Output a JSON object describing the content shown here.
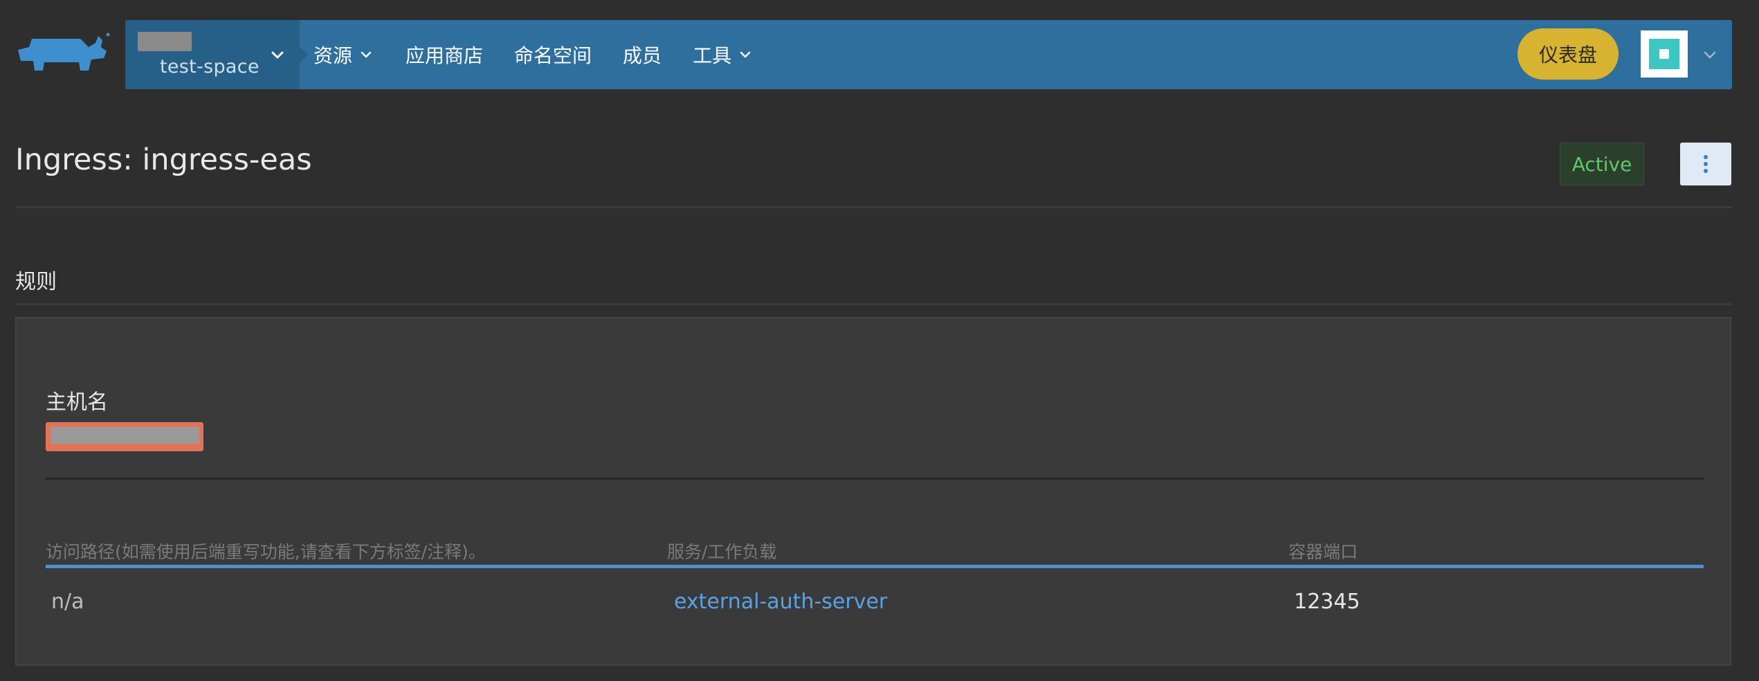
{
  "header": {
    "project_name": "test-space",
    "nav_items": [
      {
        "label": "资源",
        "has_dropdown": true
      },
      {
        "label": "应用商店",
        "has_dropdown": false
      },
      {
        "label": "命名空间",
        "has_dropdown": false
      },
      {
        "label": "成员",
        "has_dropdown": false
      },
      {
        "label": "工具",
        "has_dropdown": true
      }
    ],
    "dashboard_label": "仪表盘",
    "colors": {
      "navbar": "#2f6f9e",
      "project_switcher": "#265f88",
      "dashboard_button": "#d8b332",
      "avatar_accent": "#3ec7c2"
    },
    "icons": {
      "logo": "rancher-logo",
      "dropdown": "chevron-down-icon"
    }
  },
  "page": {
    "title": "Ingress: ingress-eas",
    "status": "Active",
    "status_color": "#5fc96a",
    "more_icon": "more-vertical-icon"
  },
  "rules": {
    "section_title": "规则",
    "hostname_label": "主机名",
    "columns": {
      "path": "访问路径(如需使用后端重写功能,请查看下方标签/注释)。",
      "target": "服务/工作负载",
      "port": "容器端口"
    },
    "rows": [
      {
        "path": "n/a",
        "target": "external-auth-server",
        "port": "12345"
      }
    ],
    "accent_color": "#4f8fcf",
    "link_color": "#5aa2e6"
  }
}
